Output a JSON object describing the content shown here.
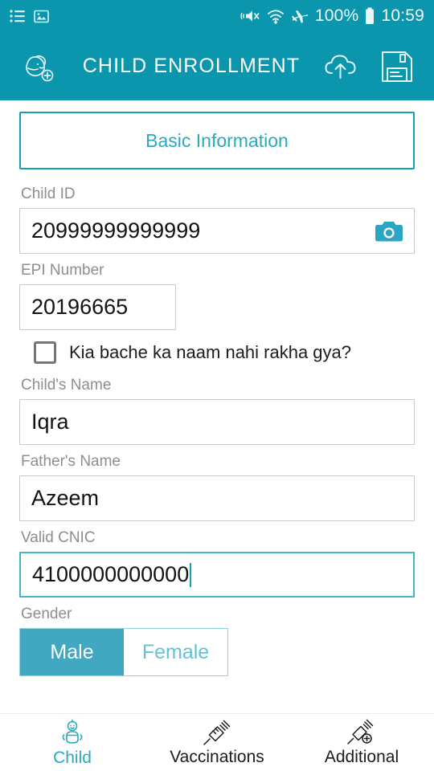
{
  "statusbar": {
    "icons_left": [
      "list-icon",
      "image-icon"
    ],
    "icons_right": [
      "vibrate-mute-icon",
      "wifi-icon",
      "airplane-mode-icon",
      "battery-icon"
    ],
    "battery_percent": "100%",
    "time": "10:59"
  },
  "appbar": {
    "logo_icon": "add-child-icon",
    "title": "CHILD ENROLLMENT",
    "upload_icon": "cloud-upload-icon",
    "save_icon": "floppy-save-icon"
  },
  "form": {
    "section_tab": "Basic Information",
    "child_id": {
      "label": "Child ID",
      "value": "20999999999999",
      "placeholder": "Child ID",
      "camera_icon": "camera-icon"
    },
    "epi_number": {
      "label": "EPI Number",
      "value": "20196665",
      "placeholder": "EPI Number"
    },
    "no_name_checkbox": {
      "label": "Kia bache ka naam nahi rakha gya?",
      "checked": false
    },
    "child_name": {
      "label": "Child's Name",
      "value": "Iqra",
      "placeholder": "Child's Name"
    },
    "father_name": {
      "label": "Father's Name",
      "value": "Azeem",
      "placeholder": "Father's Name"
    },
    "cnic": {
      "label": "Valid CNIC",
      "value": "4100000000000",
      "placeholder": "Valid CNIC",
      "focused": true
    },
    "gender": {
      "label": "Gender",
      "options": [
        "Male",
        "Female"
      ],
      "selected": "Male"
    }
  },
  "bottomnav": {
    "items": [
      {
        "label": "Child",
        "icon": "baby-icon",
        "active": true
      },
      {
        "label": "Vaccinations",
        "icon": "syringe-icon",
        "active": false
      },
      {
        "label": "Additional",
        "icon": "syringe-plus-icon",
        "active": false
      }
    ]
  },
  "colors": {
    "primary": "#0b96ae",
    "accent": "#2aa9c0",
    "segment_active": "#42a7c1",
    "label_gray": "#8e8e8e",
    "border_gray": "#c9c9c9"
  }
}
